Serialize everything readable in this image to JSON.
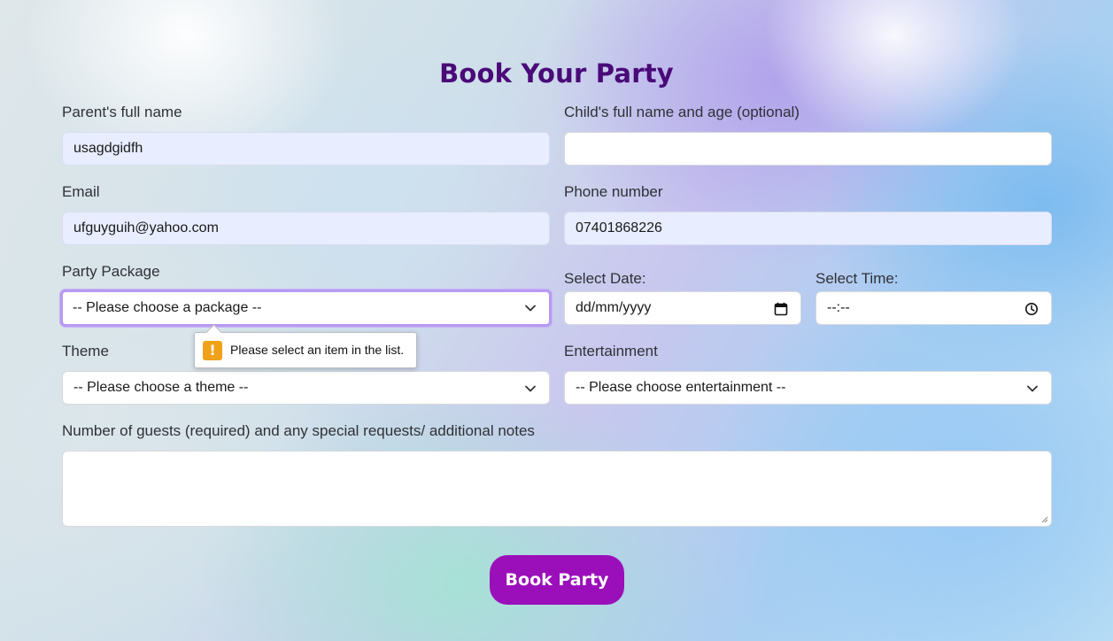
{
  "form": {
    "title": "Book Your Party",
    "parent_name": {
      "label": "Parent's full name",
      "value": "usagdgidfh"
    },
    "child_name": {
      "label": "Child's full name and age (optional)",
      "value": ""
    },
    "email": {
      "label": "Email",
      "value": "ufguyguih@yahoo.com"
    },
    "phone": {
      "label": "Phone number",
      "value": "07401868226"
    },
    "package": {
      "label": "Party Package",
      "selected": "-- Please choose a package --"
    },
    "date": {
      "label": "Select Date:",
      "placeholder": "dd/mm/yyyy"
    },
    "time": {
      "label": "Select Time:",
      "placeholder": "--:--"
    },
    "theme": {
      "label": "Theme",
      "selected": "-- Please choose a theme --"
    },
    "entertainment": {
      "label": "Entertainment",
      "selected": "-- Please choose entertainment --"
    },
    "notes": {
      "label": "Number of guests (required) and any special requests/ additional notes",
      "value": ""
    },
    "submit_label": "Book Party"
  },
  "validation_tooltip": {
    "icon": "warning-icon",
    "icon_glyph": "!",
    "message": "Please select an item in the list."
  },
  "colors": {
    "title": "#4a0a78",
    "button": "#9b0fba",
    "autofill_background": "#e8edff",
    "focus_ring": "#b79af3",
    "warning": "#f0a21a"
  }
}
